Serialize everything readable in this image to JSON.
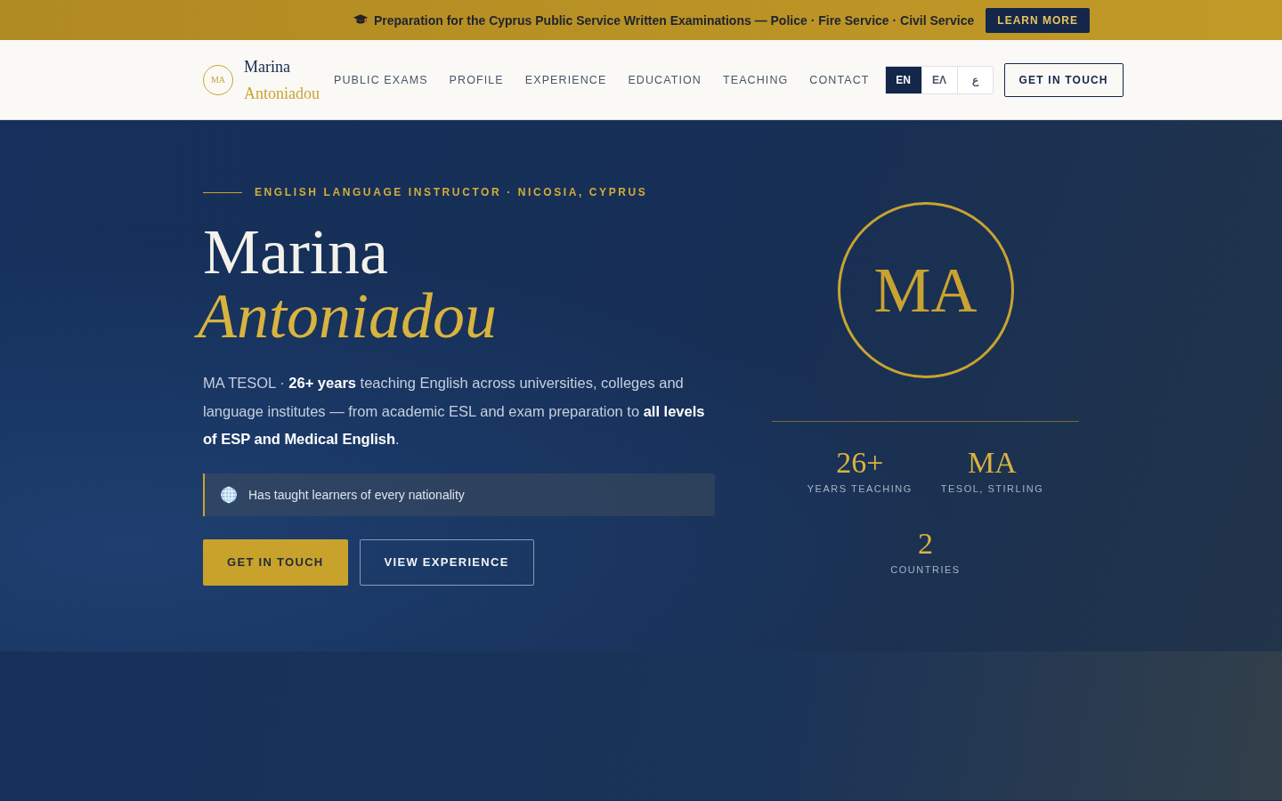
{
  "announcement": {
    "text": "Preparation for the Cyprus Public Service Written Examinations — Police · Fire Service · Civil Service",
    "button": "LEARN MORE"
  },
  "header": {
    "logo_monogram": "MA",
    "name_first": "Marina",
    "name_last": "Antoniadou",
    "nav": [
      {
        "label": "PUBLIC EXAMS"
      },
      {
        "label": "PROFILE"
      },
      {
        "label": "EXPERIENCE"
      },
      {
        "label": "EDUCATION"
      },
      {
        "label": "TEACHING"
      },
      {
        "label": "CONTACT"
      }
    ],
    "languages": [
      {
        "label": "EN",
        "selected": true
      },
      {
        "label": "ΕΛ",
        "selected": false
      },
      {
        "label": "ع",
        "selected": false
      }
    ],
    "cta": "GET IN TOUCH"
  },
  "hero": {
    "eyebrow": "ENGLISH LANGUAGE INSTRUCTOR · NICOSIA, CYPRUS",
    "title_first": "Marina",
    "title_last": "Antoniadou",
    "intro": "MA TESOL · **26+ years** teaching English across universities, colleges and language institutes — from academic ESL and exam preparation to **all levels of ESP and Medical English**.",
    "note": "Has taught learners of every nationality",
    "buttons": [
      {
        "label": "GET IN TOUCH",
        "kind": "primary"
      },
      {
        "label": "VIEW EXPERIENCE",
        "kind": "outline"
      }
    ],
    "monogram": "MA",
    "stats": [
      {
        "value": "26+",
        "label": "YEARS TEACHING"
      },
      {
        "value": "MA",
        "label": "TESOL, STIRLING"
      },
      {
        "value": "2",
        "label": "COUNTRIES"
      }
    ]
  }
}
